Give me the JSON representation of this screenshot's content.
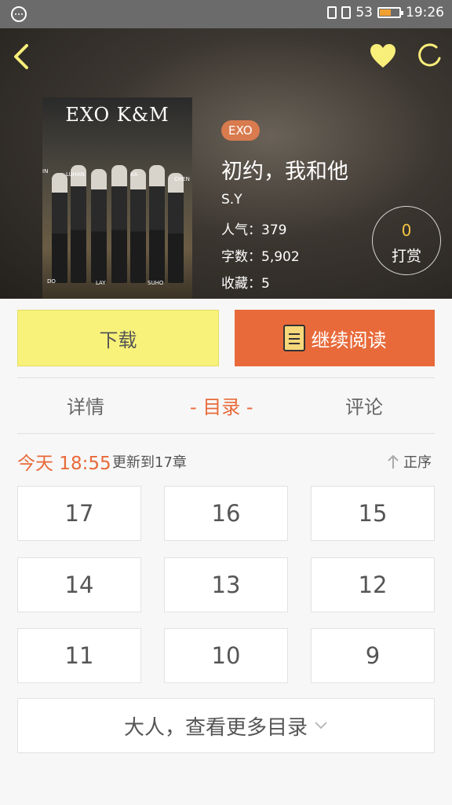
{
  "status_bar": {
    "battery": "53",
    "time": "19:26",
    "battery_level": 0.53,
    "battery_color": "#f0a030"
  },
  "book": {
    "cover_title": "EXO K&M",
    "cover_names": [
      "LUHAN",
      "KA",
      "CHEN",
      "DO",
      "LAY",
      "SUHO",
      "IN"
    ],
    "tag": "EXO",
    "title": "初约，我和他",
    "author": "S.Y",
    "popularity": "人气：379",
    "word_count": "字数：5,902",
    "favorites": "收藏：5",
    "reward_count": "0",
    "reward_label": "打赏"
  },
  "actions": {
    "download": "下载",
    "continue_reading": "继续阅读"
  },
  "tabs": {
    "details": "详情",
    "catalog": "- 目录 -",
    "comments": "评论"
  },
  "update": {
    "time": "今天 18:55",
    "text": "更新到17章",
    "sort": "正序"
  },
  "chapters": [
    "17",
    "16",
    "15",
    "14",
    "13",
    "12",
    "11",
    "10",
    "9"
  ],
  "more_label": "大人，查看更多目录",
  "colors": {
    "accent": "#e86a3a",
    "download_bg": "#f8f27a",
    "tag_bg": "#d97b4e",
    "heart": "#f8ee7a"
  }
}
